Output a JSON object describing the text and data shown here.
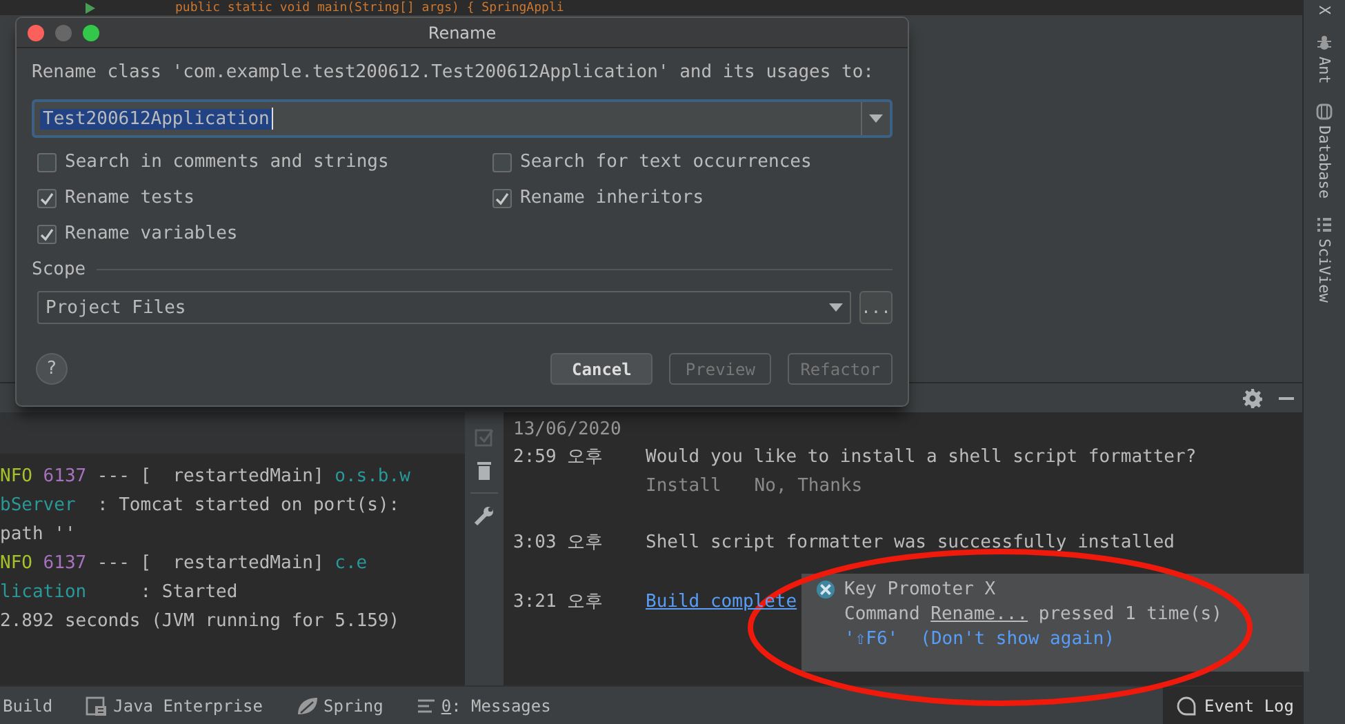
{
  "editor": {
    "code_line": "public static void main(String[] args) { SpringAppli"
  },
  "dialog": {
    "title": "Rename",
    "prompt": "Rename class 'com.example.test200612.Test200612Application' and its usages to:",
    "name_value": "Test200612Application",
    "options": [
      {
        "label": "Search in comments and strings",
        "checked": false
      },
      {
        "label": "Search for text occurrences",
        "checked": false
      },
      {
        "label": "Rename tests",
        "checked": true
      },
      {
        "label": "Rename inheritors",
        "checked": true
      },
      {
        "label": "Rename variables",
        "checked": true
      }
    ],
    "scope_label": "Scope",
    "scope_value": "Project Files",
    "browse_label": "...",
    "help_label": "?",
    "buttons": [
      {
        "label": "Cancel",
        "disabled": false
      },
      {
        "label": "Preview",
        "disabled": true
      },
      {
        "label": "Refactor",
        "disabled": true
      }
    ]
  },
  "console": {
    "lines": [
      {
        "segments": [
          {
            "text": "NFO",
            "kind": "level"
          },
          {
            "text": "6137",
            "kind": "pid"
          },
          {
            "text": " --- [  restartedMain] ",
            "kind": "plain"
          },
          {
            "text": "o.s.b.w",
            "kind": "logger"
          }
        ]
      },
      {
        "segments": [
          {
            "text": "bServer",
            "kind": "logger"
          },
          {
            "text": "  : Tomcat started on port(s):",
            "kind": "plain"
          }
        ]
      },
      {
        "segments": [
          {
            "text": "path ''",
            "kind": "plain"
          }
        ]
      },
      {
        "segments": [
          {
            "text": "NFO",
            "kind": "level"
          },
          {
            "text": "6137",
            "kind": "pid"
          },
          {
            "text": " --- [  restartedMain] ",
            "kind": "plain"
          },
          {
            "text": "c.e",
            "kind": "logger"
          }
        ]
      },
      {
        "segments": [
          {
            "text": "lication",
            "kind": "logger"
          },
          {
            "text": "     : Started",
            "kind": "plain"
          }
        ]
      },
      {
        "segments": [
          {
            "text": "2.892 seconds (JVM running for 5.159)",
            "kind": "plain"
          }
        ]
      }
    ]
  },
  "event_log": {
    "date": "13/06/2020",
    "entries": [
      {
        "time": "2:59 오후",
        "message": "Would you like to install a shell script formatter?",
        "kind": "text",
        "actions": [
          "Install",
          "No, Thanks"
        ]
      },
      {
        "time": "3:03 오후",
        "message": "Shell script formatter was successfully installed",
        "kind": "text"
      },
      {
        "time": "3:21 오후",
        "message": "Build complete",
        "kind": "link"
      }
    ]
  },
  "popup": {
    "title": "Key Promoter X",
    "command_prefix": "Command",
    "command": "Rename...",
    "command_suffix": "pressed 1 time(s)",
    "shortcut": "'⇧F6'",
    "dont_show": "(Don't show again)"
  },
  "tool_windows": [
    {
      "label": "Build",
      "kind": "build",
      "underline_first": false
    },
    {
      "label": "Java Enterprise",
      "kind": "javaee",
      "underline_first": false
    },
    {
      "label": "Spring",
      "kind": "spring",
      "underline_first": false
    },
    {
      "label": "0: Messages",
      "kind": "messages",
      "underline_first": true
    }
  ],
  "event_log_button": "Event Log",
  "right_stripe": [
    {
      "label": "X",
      "kind": "plain"
    },
    {
      "label": "Ant",
      "kind": "ant"
    },
    {
      "label": "Database",
      "kind": "database"
    },
    {
      "label": "SciView",
      "kind": "sciview"
    }
  ]
}
